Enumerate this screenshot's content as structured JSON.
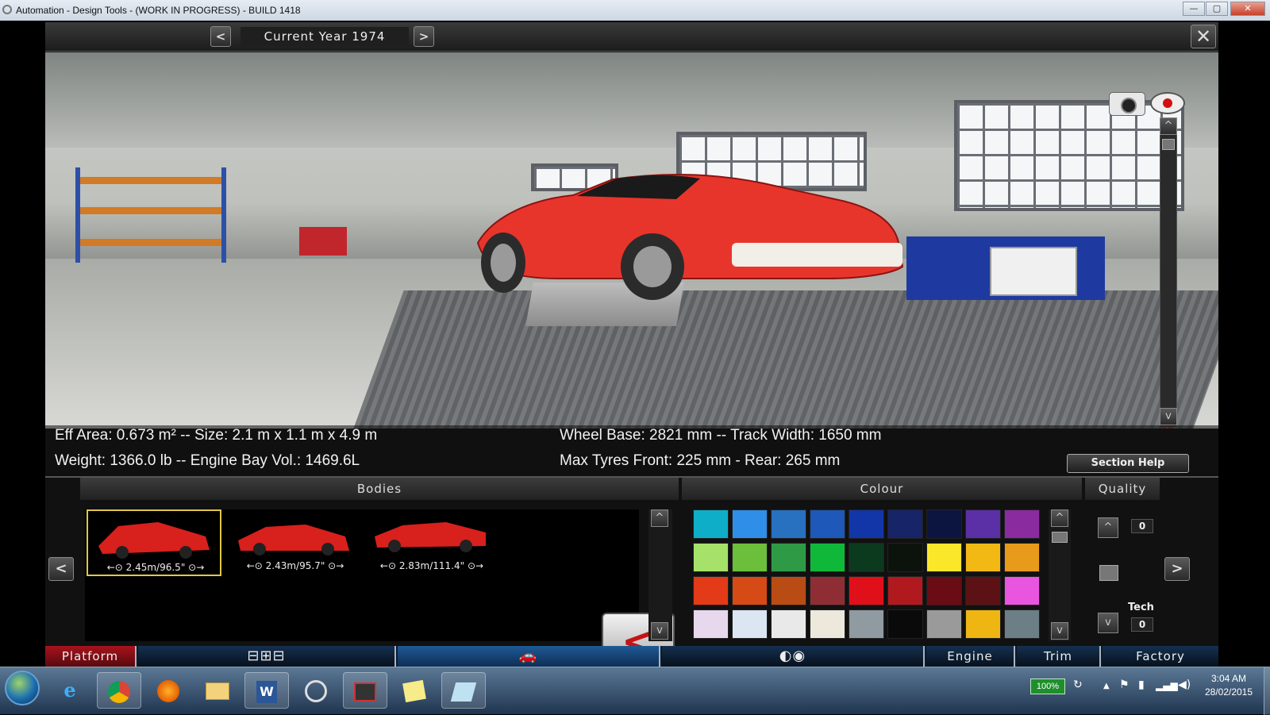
{
  "window": {
    "title": "Automation - Design Tools - (WORK IN PROGRESS) - BUILD 1418",
    "minimize_label": "—",
    "maximize_label": "▢",
    "close_label": "✕"
  },
  "topbar": {
    "prev_label": "<",
    "year_label": "Current Year 1974",
    "next_label": ">",
    "close_label": "✕"
  },
  "viewport": {
    "scroll_up_label": "^",
    "scroll_down_label": "v",
    "reset_icon_label": "✕"
  },
  "stats": {
    "line1_left": "Eff Area: 0.673 m² -- Size: 2.1 m x 1.1 m x 4.9 m",
    "line2_left": "Weight: 1366.0 lb -- Engine Bay Vol.: 1469.6L",
    "line1_right": "Wheel Base: 2821 mm -- Track Width: 1650 mm",
    "line2_right": "Max Tyres Front: 225 mm - Rear: 265 mm",
    "section_help_label": "Section Help"
  },
  "panel": {
    "bodies_title": "Bodies",
    "colour_title": "Colour",
    "quality_title": "Quality",
    "left_arrow": "<",
    "right_arrow": ">",
    "back_label": "<",
    "scroll_up": "^",
    "scroll_down": "v",
    "bodies": [
      {
        "caption": "←⊙ 2.45m/96.5\" ⊙→",
        "selected": true
      },
      {
        "caption": "←⊙ 2.43m/95.7\" ⊙→",
        "selected": false
      },
      {
        "caption": "←⊙ 2.83m/111.4\" ⊙→",
        "selected": false
      }
    ],
    "quality": {
      "value": "0",
      "tech_label": "Tech",
      "tech_value": "0"
    }
  },
  "palette": {
    "colors": [
      "#0eaec9",
      "#2e8ee8",
      "#2870c0",
      "#1e58b8",
      "#1235a8",
      "#172468",
      "#0c1540",
      "#5b2fa6",
      "#8a2ba0",
      "#a6e26a",
      "#6cbf3a",
      "#2f9a45",
      "#10b83a",
      "#0b3a1e",
      "#0c120c",
      "#fbe72a",
      "#f2b915",
      "#e89a1b",
      "#e33a18",
      "#d64a16",
      "#b94c14",
      "#8e2e34",
      "#e0101a",
      "#b01a1e",
      "#6a0c14",
      "#5c1214",
      "#ea55e0",
      "#e8d8ee",
      "#dce6f2",
      "#e9e9e9",
      "#ede8dc",
      "#8f9aa1",
      "#0a0a0a",
      "#9a9a9a",
      "#efb512",
      "#6c7e86"
    ]
  },
  "nav": {
    "tabs": [
      {
        "label": "Platform"
      },
      {
        "label": "",
        "icon": "chassis-icon"
      },
      {
        "label": "",
        "icon": "car-body-icon"
      },
      {
        "label": "",
        "icon": "lights-icon"
      },
      {
        "label": "Engine"
      },
      {
        "label": "Trim"
      },
      {
        "label": "Factory"
      }
    ]
  },
  "taskbar": {
    "battery": "100%",
    "time": "3:04 AM",
    "date": "28/02/2015",
    "apps": [
      "internet-explorer-icon",
      "chrome-icon",
      "firefox-icon",
      "file-explorer-icon",
      "word-icon",
      "app-icon",
      "photo-viewer-icon",
      "sticky-notes-icon",
      "automation-icon"
    ]
  }
}
